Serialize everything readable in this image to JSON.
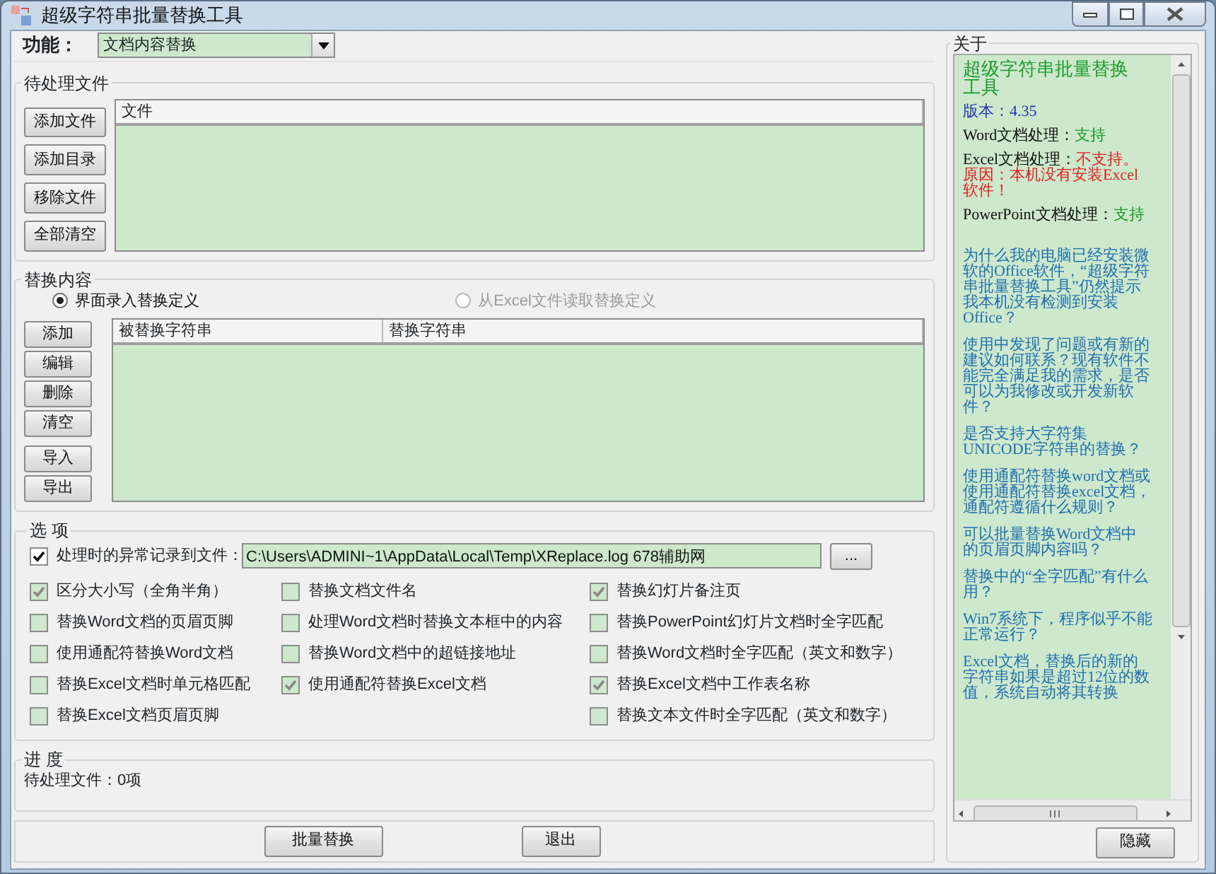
{
  "window": {
    "title": "超级字符串批量替换工具"
  },
  "function_selector": {
    "label": "功能：",
    "value": "文档内容替换"
  },
  "pending_files": {
    "title": "待处理文件",
    "buttons": [
      "添加文件",
      "添加目录",
      "移除文件",
      "全部清空"
    ],
    "columns": [
      "文件"
    ]
  },
  "replace_content": {
    "title": "替换内容",
    "sources": [
      {
        "label": "界面录入替换定义",
        "selected": true,
        "disabled": false
      },
      {
        "label": "从Excel文件读取替换定义",
        "selected": false,
        "disabled": true
      }
    ],
    "buttons": [
      "添加",
      "编辑",
      "删除",
      "清空",
      "导入",
      "导出"
    ],
    "columns": [
      "被替换字符串",
      "替换字符串"
    ]
  },
  "options": {
    "title": "选 项",
    "log_to_file": {
      "label": "处理时的异常记录到文件：",
      "checked": true
    },
    "log_path": "C:\\Users\\ADMINI~1\\AppData\\Local\\Temp\\XReplace.log 678辅助网",
    "browse_button": "...",
    "columns": [
      [
        {
          "label": "区分大小写（全角半角）",
          "checked": true
        },
        {
          "label": "替换Word文档的页眉页脚",
          "checked": false
        },
        {
          "label": "使用通配符替换Word文档",
          "checked": false
        },
        {
          "label": "替换Excel文档时单元格匹配",
          "checked": false
        },
        {
          "label": "替换Excel文档页眉页脚",
          "checked": false
        }
      ],
      [
        {
          "label": "替换文档文件名",
          "checked": false
        },
        {
          "label": "处理Word文档时替换文本框中的内容",
          "checked": false
        },
        {
          "label": "替换Word文档中的超链接地址",
          "checked": false
        },
        {
          "label": "使用通配符替换Excel文档",
          "checked": true
        }
      ],
      [
        {
          "label": "替换幻灯片备注页",
          "checked": true
        },
        {
          "label": "替换PowerPoint幻灯片文档时全字匹配",
          "checked": false
        },
        {
          "label": "替换Word文档时全字匹配（英文和数字）",
          "checked": false
        },
        {
          "label": "替换Excel文档中工作表名称",
          "checked": true
        },
        {
          "label": "替换文本文件时全字匹配（英文和数字）",
          "checked": false
        }
      ]
    ]
  },
  "progress": {
    "title": "进 度",
    "text": "待处理文件：0项"
  },
  "actions": [
    "批量替换",
    "退出"
  ],
  "about": {
    "title": "关于",
    "app_name": "超级字符串批量替换工具",
    "version": "版本：4.35",
    "support": [
      {
        "label": "Word文档处理：",
        "value": "支持",
        "supported": true
      },
      {
        "label": "Excel文档处理：",
        "value": "不支持。原因：本机没有安装Excel软件！",
        "supported": false
      },
      {
        "label": "PowerPoint文档处理：",
        "value": "支持",
        "supported": true
      }
    ],
    "faq": [
      "为什么我的电脑已经安装微软的Office软件，“超级字符串批量替换工具”仍然提示我本机没有检测到安装Office？",
      "使用中发现了问题或有新的建议如何联系？现有软件不能完全满足我的需求，是否可以为我修改或开发新软件？",
      "是否支持大字符集UNICODE字符串的替换？",
      "使用通配符替换word文档或使用通配符替换excel文档，通配符遵循什么规则？",
      "可以批量替换Word文档中的页眉页脚内容吗？",
      "替换中的“全字匹配”有什么用？",
      "Win7系统下，程序似乎不能正常运行？",
      "Excel文档，替换后的新的字符串如果是超过12位的数值，系统自动将其转换"
    ],
    "hide_button": "隐藏"
  }
}
